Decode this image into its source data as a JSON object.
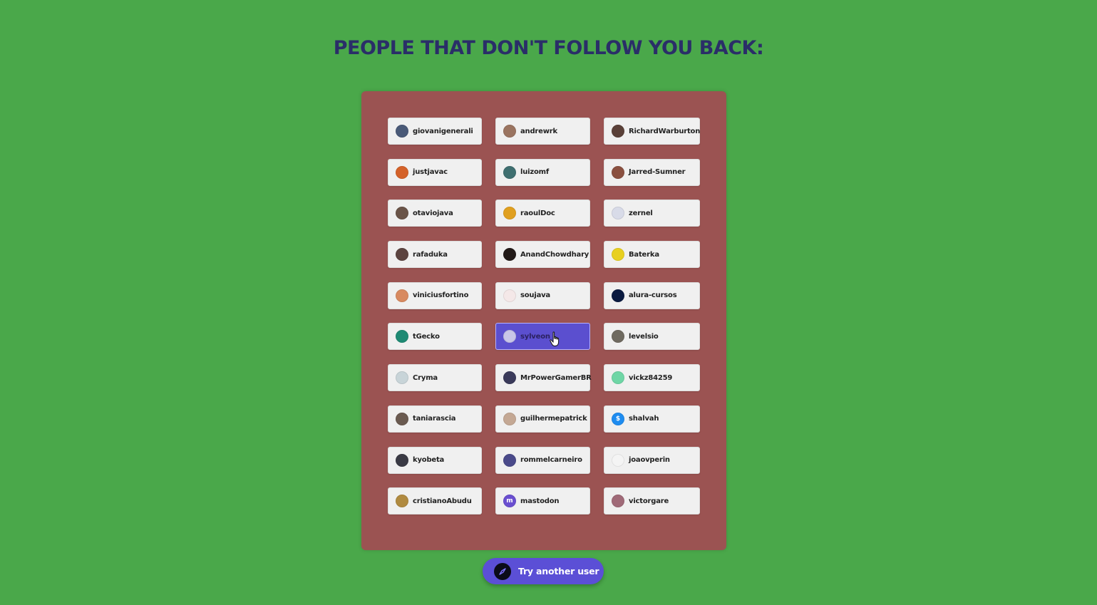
{
  "page": {
    "title": "PEOPLE THAT DON'T FOLLOW YOU BACK:"
  },
  "users": [
    {
      "username": "giovanigenerali",
      "avatar_color": "#4a5a78",
      "avatar_initial": "",
      "active": false
    },
    {
      "username": "andrewrk",
      "avatar_color": "#9a7460",
      "avatar_initial": "",
      "active": false
    },
    {
      "username": "RichardWarburton",
      "avatar_color": "#5a4038",
      "avatar_initial": "",
      "active": false
    },
    {
      "username": "justjavac",
      "avatar_color": "#d4622a",
      "avatar_initial": "",
      "active": false
    },
    {
      "username": "luizomf",
      "avatar_color": "#3f6f70",
      "avatar_initial": "",
      "active": false
    },
    {
      "username": "Jarred-Sumner",
      "avatar_color": "#8a5040",
      "avatar_initial": "",
      "active": false
    },
    {
      "username": "otaviojava",
      "avatar_color": "#6a5448",
      "avatar_initial": "",
      "active": false
    },
    {
      "username": "raoulDoc",
      "avatar_color": "#e0a020",
      "avatar_initial": "",
      "active": false
    },
    {
      "username": "zernel",
      "avatar_color": "#d8dbe8",
      "avatar_initial": "",
      "active": false
    },
    {
      "username": "rafaduka",
      "avatar_color": "#5c4440",
      "avatar_initial": "",
      "active": false
    },
    {
      "username": "AnandChowdhary",
      "avatar_color": "#221a18",
      "avatar_initial": "",
      "active": false
    },
    {
      "username": "Baterka",
      "avatar_color": "#e8d020",
      "avatar_initial": "",
      "active": false
    },
    {
      "username": "viniciusfortino",
      "avatar_color": "#d88a60",
      "avatar_initial": "",
      "active": false
    },
    {
      "username": "soujava",
      "avatar_color": "#f4e8e8",
      "avatar_initial": "",
      "active": false
    },
    {
      "username": "alura-cursos",
      "avatar_color": "#0a1a40",
      "avatar_initial": "",
      "active": false
    },
    {
      "username": "tGecko",
      "avatar_color": "#1f8a74",
      "avatar_initial": "",
      "active": false
    },
    {
      "username": "sylveon",
      "avatar_color": "#c9c6e8",
      "avatar_initial": "",
      "active": true
    },
    {
      "username": "levelsio",
      "avatar_color": "#6f6a60",
      "avatar_initial": "",
      "active": false
    },
    {
      "username": "Cryma",
      "avatar_color": "#c8d4d8",
      "avatar_initial": "",
      "active": false
    },
    {
      "username": "MrPowerGamerBR",
      "avatar_color": "#3a3a5a",
      "avatar_initial": "",
      "active": false
    },
    {
      "username": "vickz84259",
      "avatar_color": "#6fd6a6",
      "avatar_initial": "",
      "active": false
    },
    {
      "username": "taniarascia",
      "avatar_color": "#6a5a50",
      "avatar_initial": "",
      "active": false
    },
    {
      "username": "guilhermepatrick",
      "avatar_color": "#c4a894",
      "avatar_initial": "",
      "active": false
    },
    {
      "username": "shalvah",
      "avatar_color": "#1e8cf0",
      "avatar_initial": "$",
      "active": false
    },
    {
      "username": "kyobeta",
      "avatar_color": "#3a3a44",
      "avatar_initial": "",
      "active": false
    },
    {
      "username": "rommelcarneiro",
      "avatar_color": "#4a4a8a",
      "avatar_initial": "",
      "active": false
    },
    {
      "username": "joaovperin",
      "avatar_color": "#f4f4f4",
      "avatar_initial": "",
      "active": false
    },
    {
      "username": "cristianoAbudu",
      "avatar_color": "#b08a40",
      "avatar_initial": "",
      "active": false
    },
    {
      "username": "mastodon",
      "avatar_color": "#6a4fd0",
      "avatar_initial": "m",
      "active": false
    },
    {
      "username": "victorgare",
      "avatar_color": "#a06a78",
      "avatar_initial": "",
      "active": false
    }
  ],
  "try_button": {
    "label": "Try another user",
    "icon": "compass-icon"
  },
  "colors": {
    "background": "#4aa84a",
    "panel": "#9b5352",
    "title": "#2a2e68",
    "accent": "#5b4fd6"
  }
}
